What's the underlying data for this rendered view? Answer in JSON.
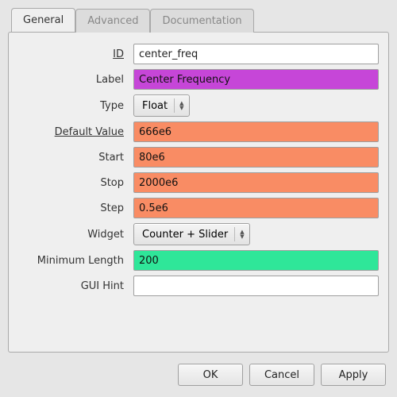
{
  "tabs": {
    "general": "General",
    "advanced": "Advanced",
    "documentation": "Documentation"
  },
  "rows": {
    "id": {
      "label": "ID",
      "value": "center_freq"
    },
    "lbl": {
      "label": "Label",
      "value": "Center Frequency"
    },
    "type": {
      "label": "Type",
      "value": "Float"
    },
    "default": {
      "label": "Default Value",
      "value": "666e6"
    },
    "start": {
      "label": "Start",
      "value": "80e6"
    },
    "stop": {
      "label": "Stop",
      "value": "2000e6"
    },
    "step": {
      "label": "Step",
      "value": "0.5e6"
    },
    "widget": {
      "label": "Widget",
      "value": "Counter + Slider"
    },
    "minlen": {
      "label": "Minimum Length",
      "value": "200"
    },
    "guihint": {
      "label": "GUI Hint",
      "value": ""
    }
  },
  "buttons": {
    "ok": "OK",
    "cancel": "Cancel",
    "apply": "Apply"
  }
}
